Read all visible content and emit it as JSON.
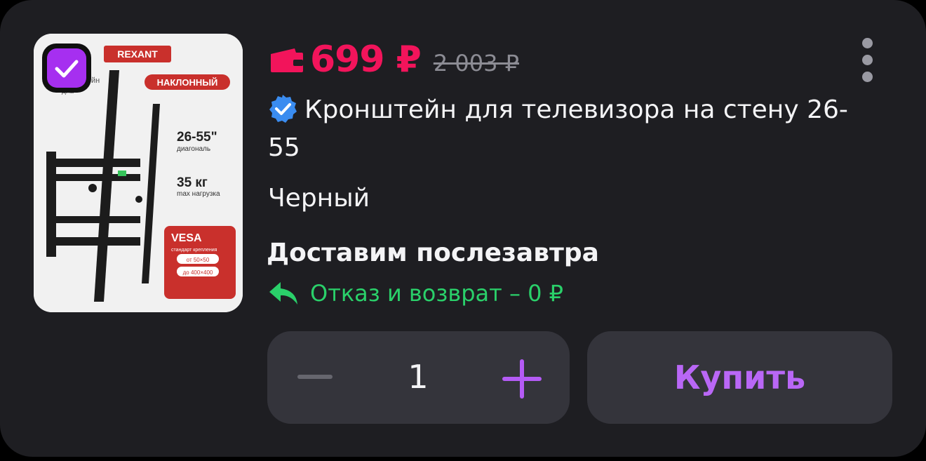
{
  "product": {
    "price": "699 ₽",
    "old_price": "2 003 ₽",
    "title": "Кронштейн для телевизора на стену 26-55",
    "color": "Черный",
    "delivery": "Доставим послезавтра",
    "refund": "Отказ и возврат – 0 ₽",
    "checked": true
  },
  "image": {
    "brand": "REXANT",
    "badge": "НАКЛОННЫЙ",
    "diagonal": "26-55\"",
    "diagonal_label": "диагональ",
    "load": "35 кг",
    "load_label": "max нагрузка",
    "vesa": "VESA",
    "vesa_label": "стандарт крепления",
    "vesa_min": "от 50×50",
    "vesa_max": "до 400×400",
    "partial_text_1": "йн",
    "partial_text_2": "диа"
  },
  "stepper": {
    "quantity": "1"
  },
  "actions": {
    "buy_label": "Купить"
  },
  "colors": {
    "accent": "#a62ff0",
    "price": "#f2145b",
    "refund": "#2ad06a",
    "buy_text": "#b967f6"
  }
}
